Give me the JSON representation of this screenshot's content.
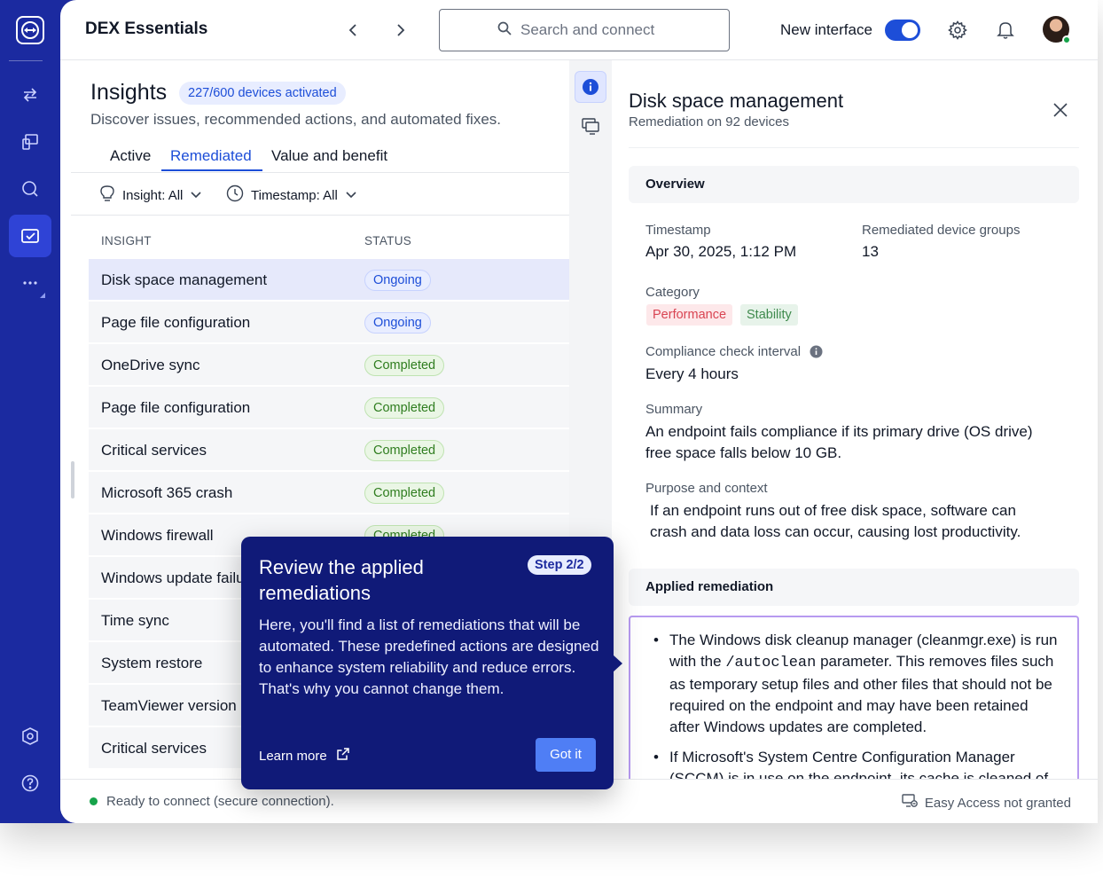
{
  "app": {
    "title": "DEX Essentials"
  },
  "rail": {
    "icons": [
      "teamviewer-logo-icon",
      "connect-arrows-icon",
      "devices-icon",
      "chat-icon",
      "insights-icon",
      "more-icon",
      "security-settings-icon",
      "help-icon"
    ]
  },
  "search": {
    "placeholder": "Search and connect"
  },
  "topbar": {
    "new_interface_label": "New interface",
    "new_interface_on": true
  },
  "insights": {
    "title": "Insights",
    "activated": "227/600 devices activated",
    "subtitle": "Discover issues, recommended actions, and automated fixes.",
    "tabs": [
      {
        "label": "Active"
      },
      {
        "label": "Remediated"
      },
      {
        "label": "Value and benefit"
      }
    ],
    "filters": [
      {
        "label": "Insight: All"
      },
      {
        "label": "Timestamp: All"
      }
    ],
    "columns": {
      "insight": "INSIGHT",
      "status": "STATUS"
    },
    "rows": [
      {
        "name": "Disk space management",
        "status": "Ongoing"
      },
      {
        "name": "Page file configuration",
        "status": "Ongoing"
      },
      {
        "name": "OneDrive sync",
        "status": "Completed"
      },
      {
        "name": "Page file configuration",
        "status": "Completed"
      },
      {
        "name": "Critical services",
        "status": "Completed"
      },
      {
        "name": "Microsoft 365 crash",
        "status": "Completed"
      },
      {
        "name": "Windows firewall",
        "status": "Completed"
      },
      {
        "name": "Windows update failure",
        "status": ""
      },
      {
        "name": "Time sync",
        "status": ""
      },
      {
        "name": "System restore",
        "status": ""
      },
      {
        "name": "TeamViewer version",
        "status": ""
      },
      {
        "name": "Critical services",
        "status": ""
      }
    ]
  },
  "detail": {
    "title": "Disk space management",
    "subtitle": "Remediation on 92 devices",
    "overview_label": "Overview",
    "timestamp_label": "Timestamp",
    "timestamp_value": "Apr 30, 2025, 1:12 PM",
    "groups_label": "Remediated device groups",
    "groups_value": "13",
    "category_label": "Category",
    "categories": [
      "Performance",
      "Stability"
    ],
    "interval_label": "Compliance check interval",
    "interval_value": "Every 4 hours",
    "summary_label": "Summary",
    "summary_text": "An endpoint fails compliance if its primary drive (OS drive) free space falls below 10 GB.",
    "purpose_label": "Purpose and context",
    "purpose_text": "If an endpoint runs out of free disk space, software can crash and data loss can occur, causing lost productivity.",
    "applied_label": "Applied remediation",
    "remediation_1_a": "The Windows disk cleanup manager (cleanmgr.exe) is run with the ",
    "remediation_1_code": "/autoclean",
    "remediation_1_b": " parameter. This removes files such as temporary setup files and other files that should not be required on the endpoint and may have been retained after Windows updates are completed.",
    "remediation_2": "If Microsoft's System Centre Configuration Manager (SCCM) is in use on the endpoint, its cache is cleaned of"
  },
  "tour": {
    "title": "Review the applied remediations",
    "step": "Step 2/2",
    "body": "Here, you'll find a list of remediations that will be automated. These predefined actions are designed to enhance system reliability and reduce errors. That's why you cannot change them.",
    "learn_more": "Learn more",
    "got_it": "Got it"
  },
  "status": {
    "left": "Ready to connect (secure connection).",
    "right": "Easy Access not granted"
  },
  "colors": {
    "rail": "#1b2aa0",
    "accent": "#1d4ed8",
    "tour_bg": "#101a78",
    "ongoing": "#1d4ed8",
    "completed": "#2f7d1f"
  }
}
